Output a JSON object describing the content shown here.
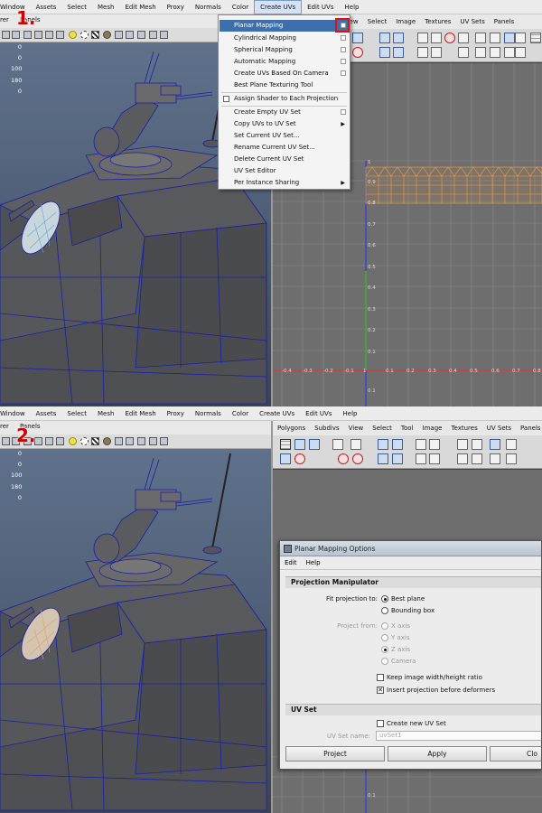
{
  "maya_menu": {
    "left_items": [
      "Window",
      "Assets",
      "Select",
      "Mesh",
      "Edit Mesh",
      "Proxy",
      "Normals",
      "Color",
      "Create UVs",
      "Edit UVs",
      "Help"
    ],
    "active_item": "Create UVs"
  },
  "viewport_menu": {
    "renderer": "Renderer",
    "panels": "Panels"
  },
  "hud_values": [
    "0",
    "0",
    "100",
    "180",
    "0"
  ],
  "uv_editor_menu": {
    "panel1": [
      "View",
      "Select",
      "Image",
      "Textures",
      "UV Sets",
      "Panels"
    ],
    "panel2": [
      "Polygons",
      "Subdivs",
      "View",
      "Select",
      "Tool",
      "Image",
      "Textures",
      "UV Sets",
      "Panels"
    ]
  },
  "uv_axes": {
    "v_labels": [
      "1",
      "0.9",
      "0.8",
      "0.7",
      "0.6",
      "0.5",
      "0.4",
      "0.3",
      "0.2",
      "0.1",
      "0.1"
    ],
    "u_labels": [
      "-0.4",
      "-0.3",
      "-0.2",
      "-0.1",
      "1",
      "0.1",
      "0.2",
      "0.3",
      "0.4",
      "0.5",
      "0.6",
      "0.7",
      "0.8"
    ],
    "bottom_label": "0.1"
  },
  "create_uvs_menu": {
    "items": [
      {
        "label": "Planar Mapping",
        "option_box": true,
        "highlighted": true
      },
      {
        "label": "Cylindrical Mapping",
        "option_box": true
      },
      {
        "label": "Spherical Mapping",
        "option_box": true
      },
      {
        "label": "Automatic Mapping",
        "option_box": true
      },
      {
        "label": "Create UVs Based On Camera",
        "option_box": true
      },
      {
        "label": "Best Plane Texturing Tool",
        "option_box": false
      },
      {
        "label": "Assign Shader to Each Projection",
        "checkbox": true
      },
      {
        "label": "Create Empty UV Set",
        "option_box": true
      },
      {
        "label": "Copy UVs to UV Set",
        "submenu": true
      },
      {
        "label": "Set Current UV Set..."
      },
      {
        "label": "Rename Current UV Set..."
      },
      {
        "label": "Delete Current UV Set"
      },
      {
        "label": "UV Set Editor"
      },
      {
        "label": "Per Instance Sharing",
        "submenu": true
      }
    ]
  },
  "step_labels": [
    "1.",
    "2."
  ],
  "options_dialog": {
    "title": "Planar Mapping Options",
    "menu": [
      "Edit",
      "Help"
    ],
    "section_projection": "Projection Manipulator",
    "fit_label": "Fit projection to:",
    "fit_options": [
      "Best plane",
      "Bounding box"
    ],
    "fit_selected": "Best plane",
    "project_from_label": "Project from:",
    "project_from_options": [
      "X axis",
      "Y axis",
      "Z axis",
      "Camera"
    ],
    "project_from_selected": "Z axis",
    "keep_ratio_label": "Keep image width/height ratio",
    "keep_ratio_checked": false,
    "insert_projection_label": "Insert projection before deformers",
    "insert_projection_checked": true,
    "section_uvset": "UV Set",
    "create_new_uvset_label": "Create new UV Set",
    "create_new_uvset_checked": false,
    "uvset_name_label": "UV Set name:",
    "uvset_name_value": "uvSet1",
    "buttons": {
      "project": "Project",
      "apply": "Apply",
      "close": "Clo"
    }
  },
  "colors": {
    "menu_highlight": "#3e6fad",
    "callout_red": "#e01010",
    "uv_grid": "#6e6e6e",
    "uv_mesh": "#f0a040",
    "wireframe": "#1a1fa8"
  }
}
